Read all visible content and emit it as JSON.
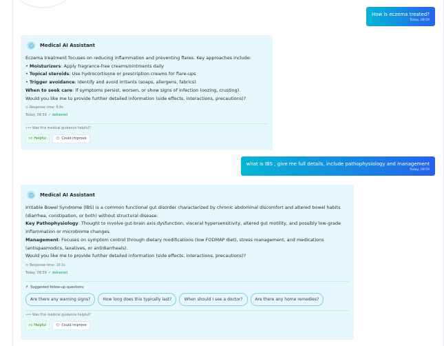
{
  "messages": {
    "user1": {
      "text": "How is eczema treated?",
      "time": "Today, 08:59"
    },
    "ai1": {
      "sender": "Medical AI Assistant",
      "intro": "Eczema treatment focuses on reducing inflammation and preventing flares. Key approaches include:",
      "bullets": [
        {
          "label": "Moisturizers",
          "text": ": Apply fragrance-free creams/ointments daily"
        },
        {
          "label": "Topical steroids",
          "text": ": Use hydrocortisone or prescription creams for flare-ups"
        },
        {
          "label": "Trigger avoidance",
          "text": ": Identify and avoid irritants (soaps, allergens, fabrics)"
        }
      ],
      "seek_label": "When to seek care",
      "seek_text": ": If symptoms persist, worsen, or show signs of infection (oozing, crusting).",
      "closing": "Would you like me to provide further detailed information (side effects, interactions, precautions)?",
      "response_time": "Response time: 8.8s",
      "time": "Today, 08:59",
      "status": "delivered",
      "feedback_question": "Was this medical guidance helpful?",
      "helpful_label": "Helpful",
      "improve_label": "Could improve"
    },
    "user2": {
      "text": "what is IBS ,  give me full details, include pathophysiology and management",
      "time": "Today, 08:59"
    },
    "ai2": {
      "sender": "Medical AI Assistant",
      "intro": "Irritable Bowel Syndrome (IBS) is a common functional gut disorder characterized by chronic abdominal discomfort and altered bowel habits (diarrhea, constipation, or both) without structural disease.",
      "patho_label": "Key Pathophysiology",
      "patho_text": ": Thought to involve gut-brain axis dysfunction, visceral hypersensitivity, altered gut motility, and possibly low-grade inflammation or microbiome changes.",
      "mgmt_label": "Management",
      "mgmt_text": ": Focuses on symptom control through dietary modifications (low FODMAP diet), stress management, and medications (antispasmodics, laxatives, or antidiarrheals).",
      "closing": "Would you like me to provide further detailed information (side effects, interactions, precautions)?",
      "response_time": "Response time: 10.1s",
      "time": "Today, 08:59",
      "status": "delivered",
      "suggested_title": "Suggested follow-up questions:",
      "suggestions": [
        "Are there any warning signs?",
        "How long does this typically last?",
        "When should I see a doctor?",
        "Are there any home remedies?"
      ],
      "feedback_question": "Was this medical guidance helpful?",
      "helpful_label": "Helpful",
      "improve_label": "Could improve"
    }
  }
}
